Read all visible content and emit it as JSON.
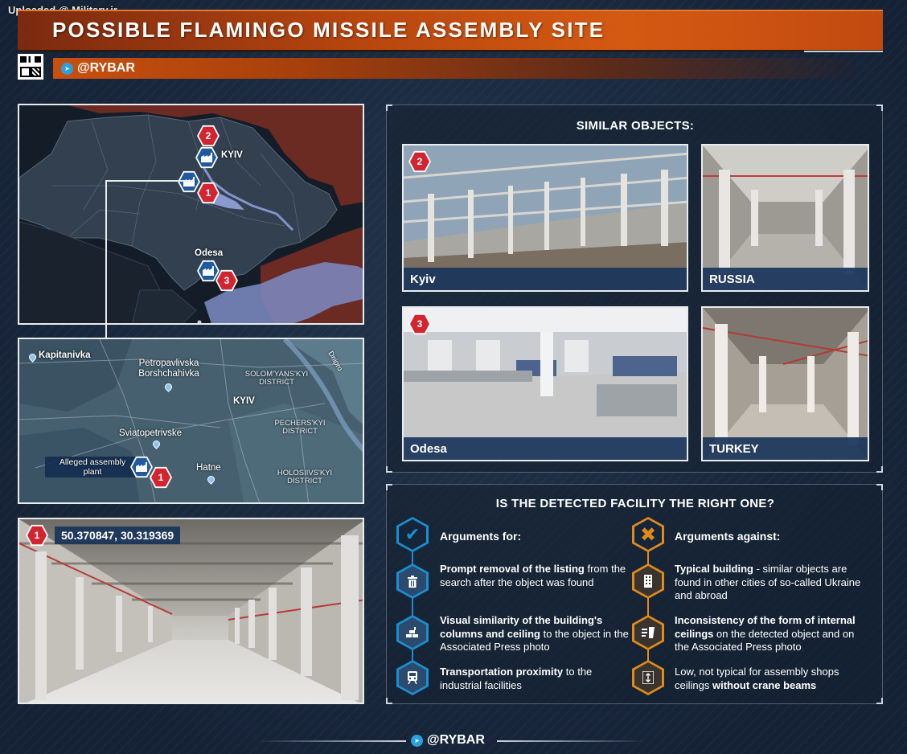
{
  "header": {
    "watermark": "Uploaded @ Military.ir",
    "title": "POSSIBLE FLAMINGO MISSILE ASSEMBLY SITE",
    "brand": "@RYBAR"
  },
  "map_top": {
    "labels": {
      "kyiv": "KYIV",
      "odesa": "Odesa"
    },
    "markers": [
      "2",
      "1",
      "3"
    ]
  },
  "map_sat": {
    "places": {
      "kapitanivka": "Kapitanivka",
      "petropavlivska": "Petropavlivska Borshchahivka",
      "kyiv": "KYIV",
      "solomyanskyi": "SOLOM'YANS'KYI DISTRICT",
      "pecherskyi": "PECHERS'KYI DISTRICT",
      "sviatopetrivske": "Sviatopetrivske",
      "hatne": "Hatne",
      "holosiivskyi": "HOLOSIIVS'KYI DISTRICT",
      "dnipro": "Dnipro"
    },
    "plant_label": "Alleged assembly plant",
    "plant_marker": "1"
  },
  "photo_main": {
    "marker": "1",
    "coordinates": "50.370847, 30.319369"
  },
  "similar": {
    "title": "SIMILAR OBJECTS:",
    "items": [
      {
        "caption": "Kyiv",
        "marker": "2"
      },
      {
        "caption": "RUSSIA",
        "marker": ""
      },
      {
        "caption": "Odesa",
        "marker": "3"
      },
      {
        "caption": "TURKEY",
        "marker": ""
      }
    ]
  },
  "question": {
    "title": "IS THE DETECTED FACILITY THE RIGHT ONE?",
    "for": {
      "heading": "Arguments for:",
      "items": [
        {
          "strong": "Prompt removal of the listing",
          "rest": " from the search after the object was found",
          "icon": "trash-icon"
        },
        {
          "strong": "Visual similarity of the building's columns and ceiling",
          "rest": " to the object in the Associated Press photo",
          "icon": "bricks-icon"
        },
        {
          "strong": "Transportation proximity",
          "rest": " to the industrial facilities",
          "icon": "train-icon"
        }
      ]
    },
    "against": {
      "heading": "Arguments against:",
      "items": [
        {
          "strong": "Typical building",
          "rest": " - similar objects are found in other cities of so-called Ukraine and abroad",
          "icon": "building-icon"
        },
        {
          "strong": "Inconsistency of the form of internal ceilings",
          "rest": " on the detected object and on the Associated Press photo",
          "icon": "ceiling-icon"
        },
        {
          "pre": "Low, not typical for assembly shops ceilings ",
          "strong": "without crane beams",
          "icon": "height-icon"
        }
      ]
    }
  },
  "footer": {
    "brand": "@RYBAR"
  },
  "colors": {
    "accent_orange": "#d45a12",
    "marker_red": "#d32531",
    "for_blue": "#1a8fd0",
    "against_orange": "#e08a1a",
    "caption_blue": "#19345a"
  }
}
